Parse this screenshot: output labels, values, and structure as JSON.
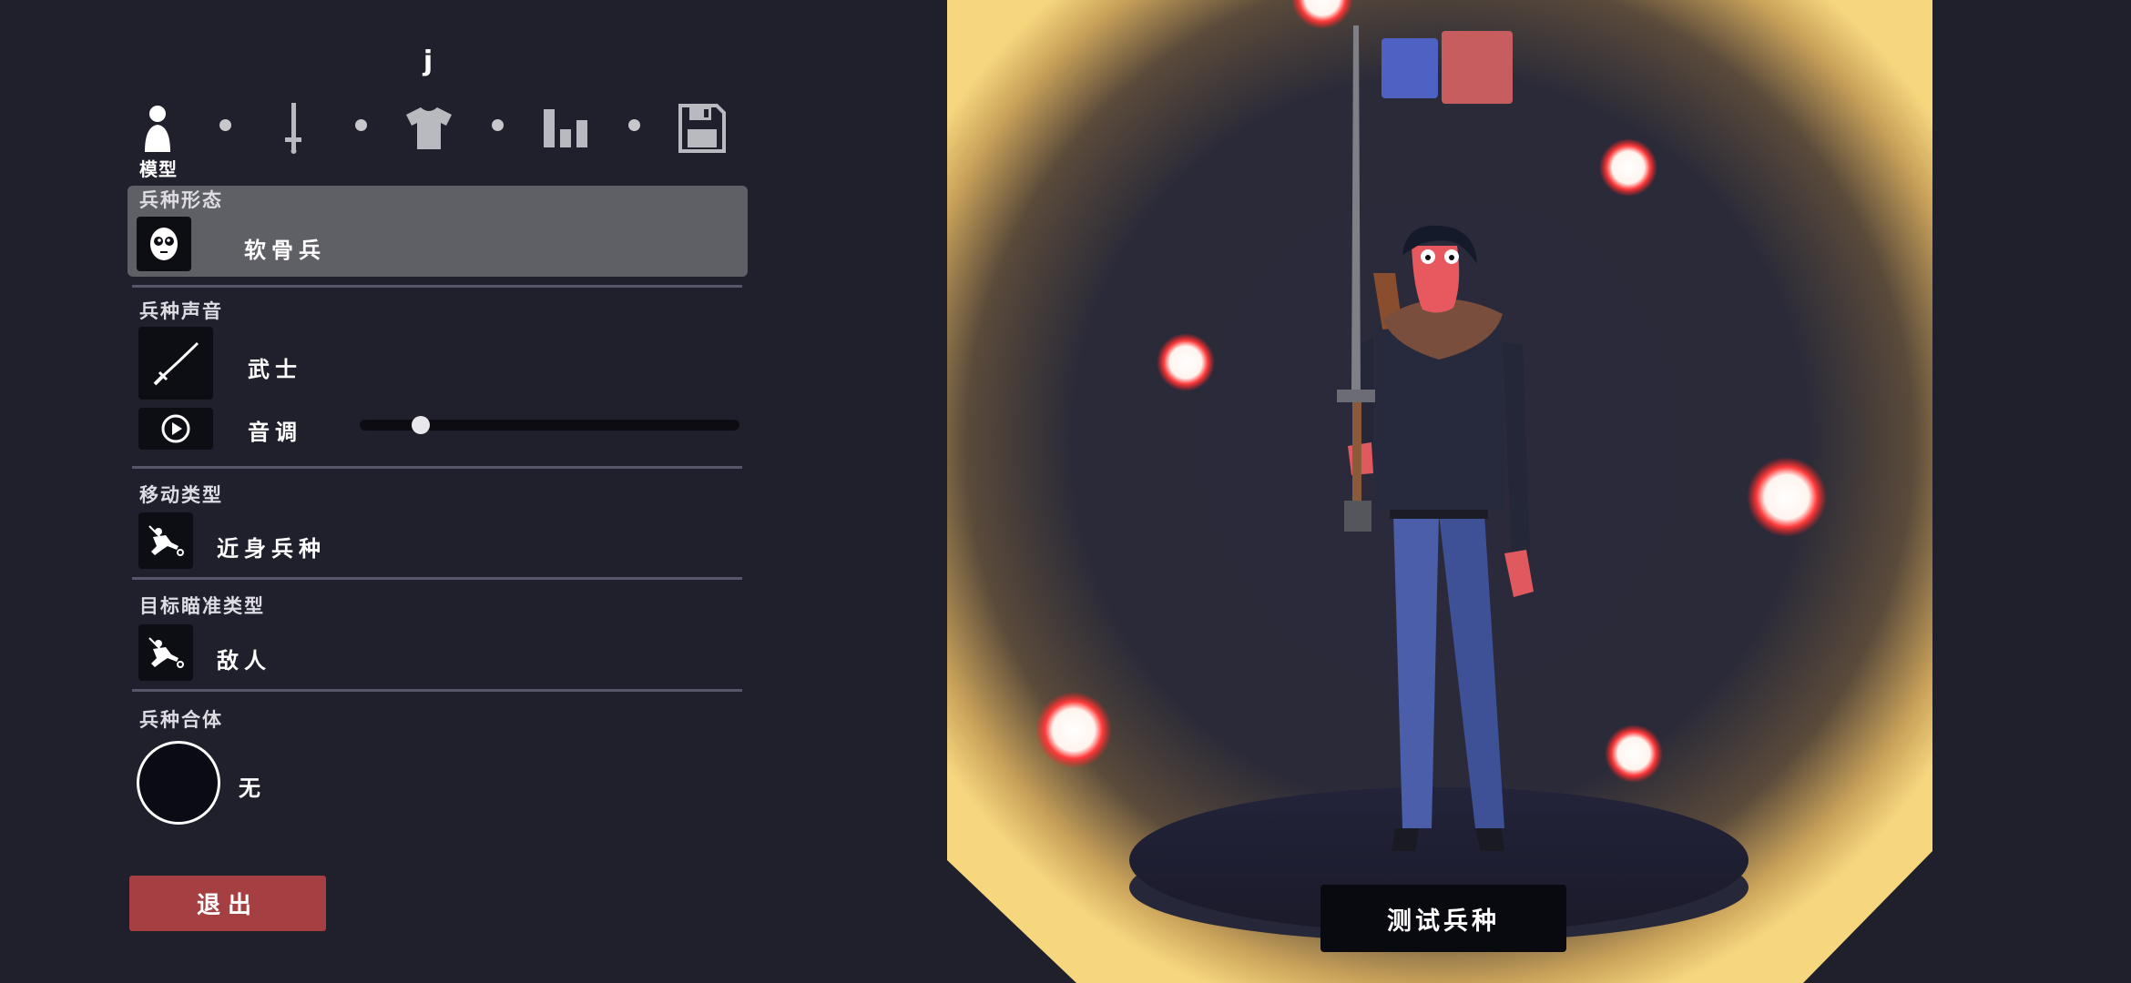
{
  "unit": {
    "name": "j"
  },
  "tabs": {
    "active_label": "模型",
    "items": [
      {
        "icon": "person-icon",
        "active": true
      },
      {
        "icon": "sword-icon",
        "active": false
      },
      {
        "icon": "shirt-icon",
        "active": false
      },
      {
        "icon": "stats-icon",
        "active": false
      },
      {
        "icon": "save-icon",
        "active": false
      }
    ]
  },
  "sections": {
    "form": {
      "title": "兵种形态",
      "value": "软骨兵",
      "icon": "skull-face-icon"
    },
    "voice": {
      "title": "兵种声音",
      "value": "武士",
      "icon": "katana-icon",
      "pitch_label": "音调",
      "pitch_value": 0.16,
      "play_icon": "play-icon"
    },
    "movement": {
      "title": "移动类型",
      "value": "近身兵种",
      "icon": "melee-unit-icon"
    },
    "targeting": {
      "title": "目标瞄准类型",
      "value": "敌人",
      "icon": "melee-unit-icon"
    },
    "combine": {
      "title": "兵种合体",
      "value": "无"
    }
  },
  "buttons": {
    "exit": "退出",
    "test_unit": "测试兵种"
  },
  "teams": {
    "colors": [
      "#4f62c4",
      "#c75d5f"
    ],
    "selected": 1
  },
  "colors": {
    "panel_bg": "#20202d",
    "accent_red": "#a53f42",
    "glow": "#f3cc70"
  }
}
